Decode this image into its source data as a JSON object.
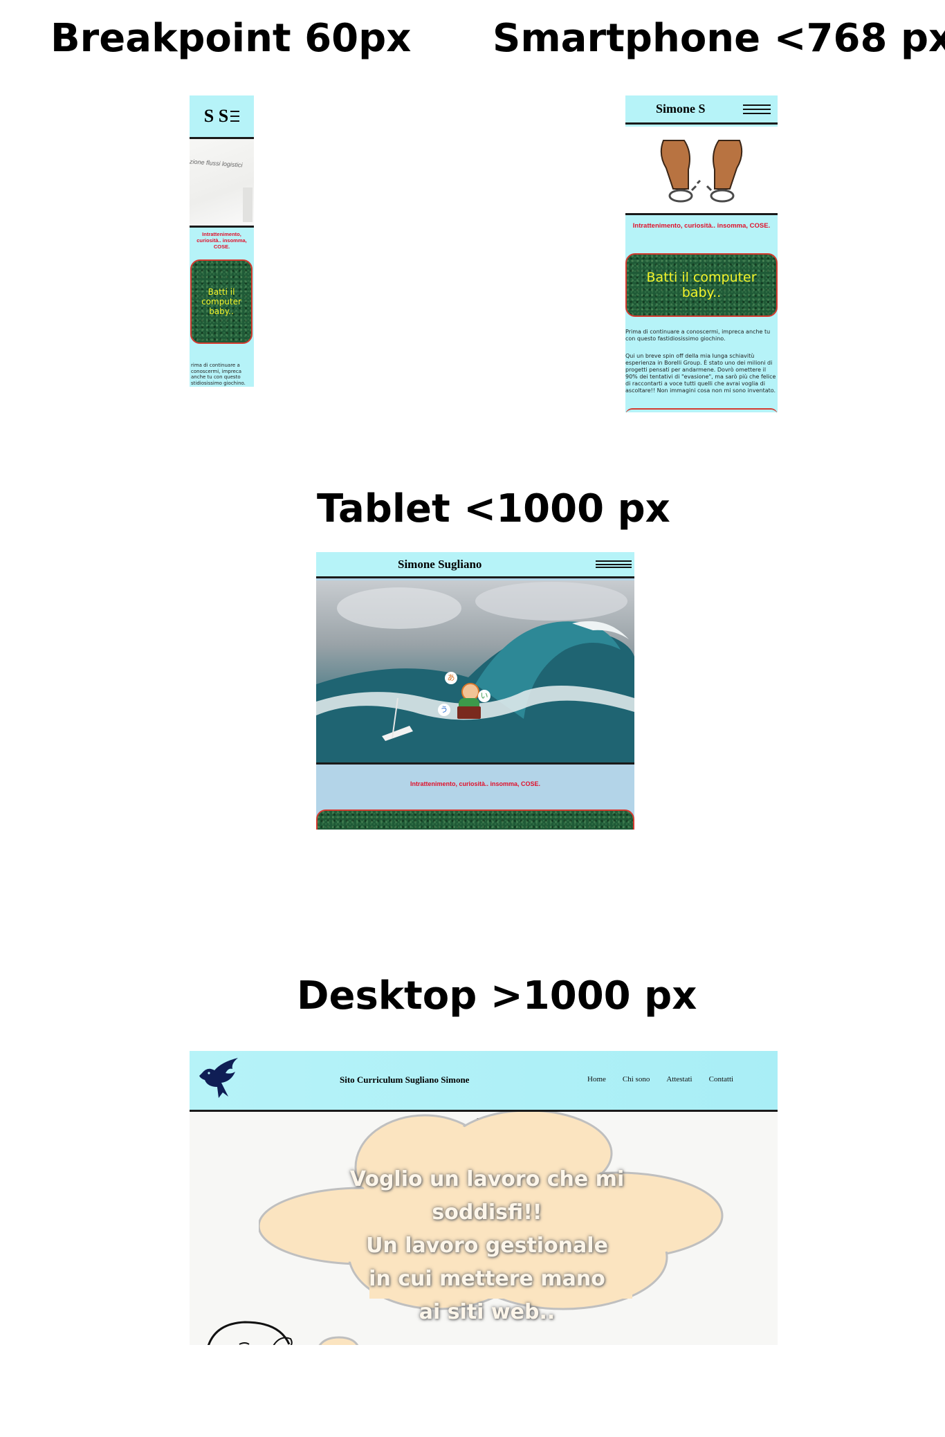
{
  "headings": {
    "breakpoint": "Breakpoint 60px",
    "smartphone": "Smartphone <768 px",
    "tablet": "Tablet <1000 px",
    "desktop": "Desktop >1000 px"
  },
  "colors": {
    "header_bg": "#b6f3f8",
    "tagline_red": "#e0112b",
    "grass_green": "#1f5a37",
    "button_text_yellow": "#f3f32a",
    "button_border": "#d43a2f",
    "bird_navy": "#0f1e55"
  },
  "mini_preview": {
    "logo": "S S",
    "menu_icon": "hamburger-icon",
    "hero_caption": "zione flussi logistici",
    "tagline": "Intrattenimento, curiosità.. insomma, COSE.",
    "button_label": "Batti il computer baby..",
    "intro_text": "rima di continuare a conoscermi, impreca anche tu con questo stidiosissimo giochino."
  },
  "smartphone_preview": {
    "logo": "Simone S",
    "menu_icon": "hamburger-icon",
    "hero_image": "broken-handcuffs-image",
    "tagline": "Intrattenimento, curiosità.. insomma, COSE.",
    "button_label": "Batti il computer baby..",
    "paragraph_1": "Prima di continuare a conoscermi, impreca anche tu con questo fastidiosissimo giochino.",
    "paragraph_2": "Qui un breve spin off della mia lunga schiavitù esperienza in Borelli Group. È stato uno dei milioni di progetti pensati per andarmene. Dovrò omettere il 90% dei tentativi di \"evasione\", ma sarò più che felice di raccontarti a voce tutti quelli che avrai voglia di ascoltare!! Non immagini cosa non mi sono inventato."
  },
  "tablet_preview": {
    "logo": "Simone Sugliano",
    "menu_icon": "hamburger-icon",
    "hero_image": "ocean-wave-image",
    "tagline": "Intrattenimento, curiosità.. insomma, COSE.",
    "bubble_chars": [
      "あ",
      "い",
      "う"
    ]
  },
  "desktop_preview": {
    "logo_icon": "bird-icon",
    "site_title": "Sito Curriculum Sugliano Simone",
    "nav": [
      "Home",
      "Chi sono",
      "Attestati",
      "Contatti"
    ],
    "cloud_text": [
      "Voglio un lavoro che mi",
      "soddisfi!!",
      "Un lavoro gestionale",
      "in cui mettere mano",
      "ai siti web.."
    ]
  }
}
